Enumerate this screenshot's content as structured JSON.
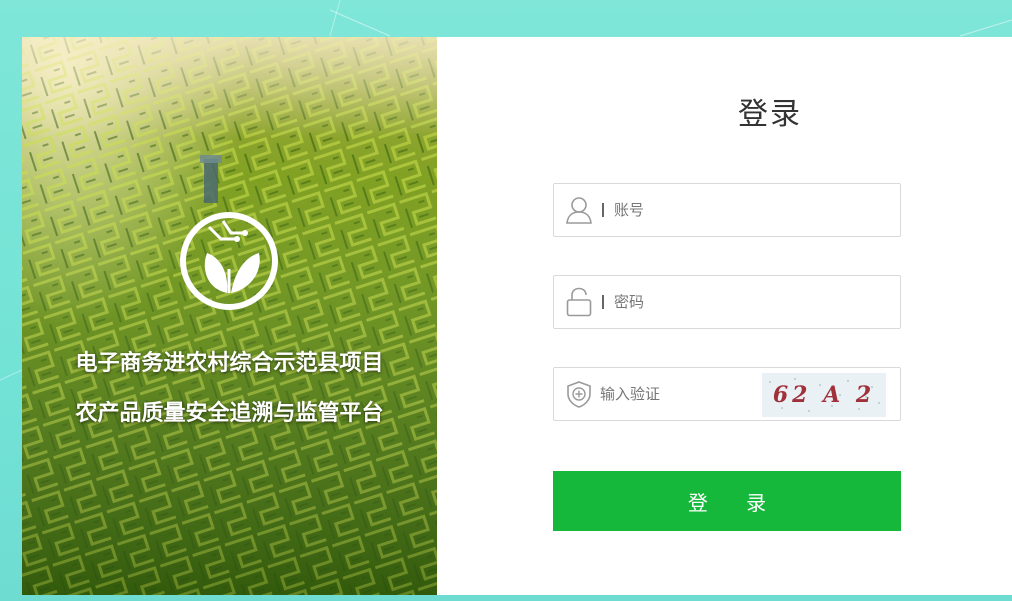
{
  "hero": {
    "tagline_line1": "电子商务进农村综合示范县项目",
    "tagline_line2": "农产品质量安全追溯与监管平台",
    "logo_icon": "leaf-circuit-logo-icon"
  },
  "login": {
    "title": "登录",
    "account": {
      "placeholder": "账号",
      "icon": "user-icon"
    },
    "password": {
      "placeholder": "密码",
      "icon": "lock-icon"
    },
    "captcha": {
      "placeholder": "输入验证",
      "icon": "shield-plus-icon",
      "code": "62 A 2"
    },
    "submit_label": "登 录"
  },
  "colors": {
    "accent_green": "#15b83a",
    "background_teal": "#73e3d6"
  }
}
